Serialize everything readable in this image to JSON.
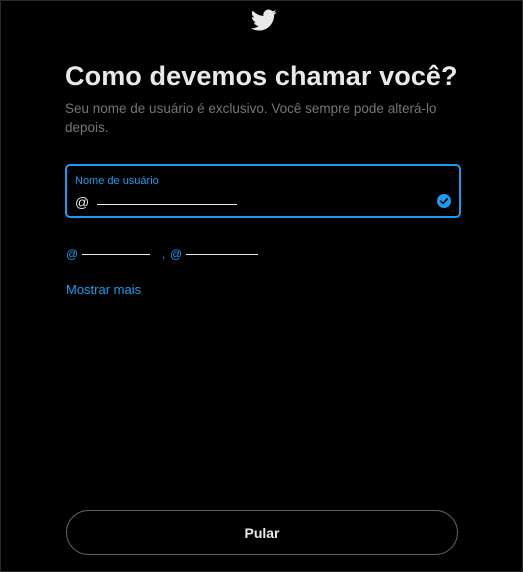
{
  "header": {
    "logo_icon": "twitter-bird-icon",
    "title": "Como devemos chamar você?",
    "subtitle": "Seu nome de usuário é exclusivo. Você sempre pode alterá-lo depois."
  },
  "username_field": {
    "label": "Nome de usuário",
    "prefix": "@",
    "status_icon": "checkmark-circle-icon"
  },
  "suggestions": {
    "items": [
      {
        "prefix": "@"
      },
      {
        "prefix": "@"
      }
    ],
    "separator": ","
  },
  "show_more": {
    "label": "Mostrar mais"
  },
  "footer": {
    "skip_label": "Pular"
  },
  "colors": {
    "background": "#000000",
    "accent": "#1d9bf0",
    "text_primary": "#e7e9ea",
    "text_secondary": "#71767b",
    "border": "#536471"
  }
}
